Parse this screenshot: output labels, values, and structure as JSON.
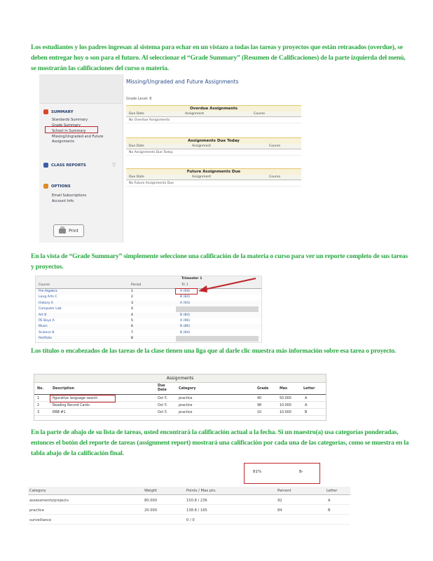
{
  "paragraphs": {
    "p1": "Los estudiantes y los padres ingresan al sistema para echar en un vistazo a todas las tareas y proyectos que están retrasados (overdue), se deben entregar hoy o son para el futuro. Al seleccionar el “Grade Summary” (Resumen de Calificaciones) de la parte izquierda del menú, se mostrarán las calificaciones del curso o materia.",
    "p2": "En la vista de “Grade Summary” simplemente seleccione una calificación de la materia o curso para ver un reporte completo de sus tareas y proyectos.",
    "p3": "Los títulos o encabezados de las tareas de la clase tienen una liga que al darle clic muestra más información sobre esa tarea o proyecto.",
    "p4": "En la parte de abajo de su lista de tareas, usted encontrará la calificación actual a la fecha. Si un maestro(a) usa categorías ponderadas, entonces el botón del reporte de tareas (assignment report) mostrará una calificación por cada una de las categorías, como se muestra en la tabla abajo de la calificación final."
  },
  "shot1": {
    "title": "Missing/Ungraded and Future Assignments",
    "subtitle": "Grade Level: 8",
    "nav": {
      "summary_head": "SUMMARY",
      "summary_items": [
        "Standards Summary",
        "Grade Summary",
        "School in Summary",
        "Missing/Ungraded and Future",
        "Assignments"
      ],
      "reports_head": "CLASS REPORTS",
      "options_head": "OPTIONS",
      "options_items": [
        "Email Subscriptions",
        "Account Info"
      ],
      "print_label": "Print"
    },
    "sections": [
      {
        "title": "Overdue Assignments",
        "cols": [
          "Due Date",
          "Assignment",
          "Course"
        ],
        "row": "No Overdue Assignments"
      },
      {
        "title": "Assignments Due Today",
        "cols": [
          "Due Date",
          "Assignment",
          "Course"
        ],
        "row": "No Assignments Due Today"
      },
      {
        "title": "Future Assignments Due",
        "cols": [
          "Due Date",
          "Assignment",
          "Course"
        ],
        "row": "No Future Assignments Due"
      }
    ]
  },
  "shot2": {
    "group_header": "Trimester 1",
    "col_course": "Course",
    "col_period": "Period",
    "col_term": "Tri 1",
    "rows": [
      {
        "course": "Pre-Algebra",
        "period": "1",
        "grade": "A (94)"
      },
      {
        "course": "Lang Arts C",
        "period": "2",
        "grade": "B (84)"
      },
      {
        "course": "History A",
        "period": "3",
        "grade": "A (93)"
      },
      {
        "course": "Computer Lab",
        "period": "4",
        "grade": ""
      },
      {
        "course": "Art 8",
        "period": "4",
        "grade": "B (84)"
      },
      {
        "course": "PE Boys A",
        "period": "5",
        "grade": "A (96)"
      },
      {
        "course": "Music",
        "period": "6",
        "grade": "B (86)"
      },
      {
        "course": "Science 8",
        "period": "7",
        "grade": "B (84)"
      },
      {
        "course": "Portfolio",
        "period": "8",
        "grade": ""
      }
    ]
  },
  "shot3": {
    "title": "Assignments",
    "cols": [
      "No.",
      "Description",
      "Due Date",
      "Category",
      "Grade",
      "Max",
      "Letter"
    ],
    "rows": [
      {
        "no": "1",
        "desc": "figurative language search",
        "due": "Oct 5",
        "cat": "practice",
        "grade": "40",
        "max": "50.000",
        "letter": "A"
      },
      {
        "no": "2",
        "desc": "Reading Record Cards",
        "due": "Oct 5",
        "cat": "practice",
        "grade": "98",
        "max": "10.000",
        "letter": "A"
      },
      {
        "no": "3",
        "desc": "RRB #1",
        "due": "Oct 5",
        "cat": "practice",
        "grade": "10",
        "max": "10.000",
        "letter": "B"
      }
    ]
  },
  "shot4": {
    "percent": "81%",
    "letter": "B-"
  },
  "shot5": {
    "cols": [
      "Category",
      "Weight",
      "Points / Max pts.",
      "Percent",
      "Letter"
    ],
    "rows": [
      {
        "category": "assessments/projects",
        "weight": "80.000",
        "points": "150.8 / 236",
        "percent": "92",
        "letter": "A"
      },
      {
        "category": "practice",
        "weight": "20.000",
        "points": "138.8 / 165",
        "percent": "84",
        "letter": "B"
      },
      {
        "category": "surveillance",
        "weight": "",
        "points": "0 / 0",
        "percent": "",
        "letter": ""
      }
    ]
  },
  "colors": {
    "accent_text": "#2aa843",
    "highlight": "#c0242b",
    "link": "#1f4fa8"
  }
}
